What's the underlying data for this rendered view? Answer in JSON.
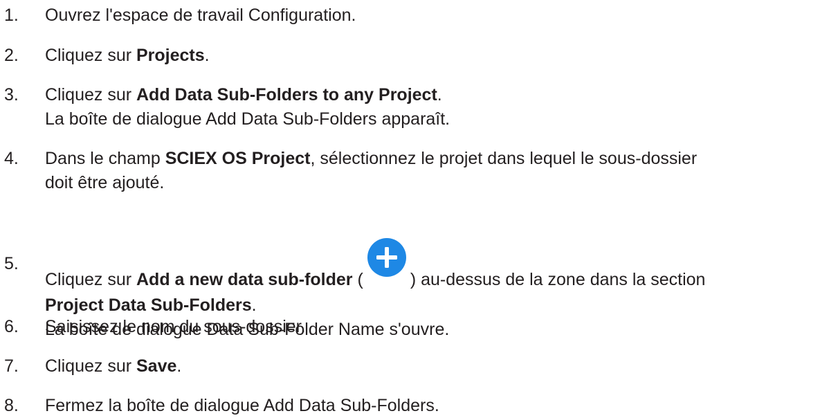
{
  "steps": [
    {
      "number": "1.",
      "text": "Ouvrez l'espace de travail Configuration."
    },
    {
      "number": "2.",
      "prefix": "Cliquez sur ",
      "bold": "Projects",
      "suffix": "."
    },
    {
      "number": "3.",
      "prefix": "Cliquez sur ",
      "bold": "Add Data Sub-Folders to any Project",
      "suffix": ".",
      "result": "La boîte de dialogue Add Data Sub-Folders apparaît."
    },
    {
      "number": "4.",
      "prefix": "Dans le champ ",
      "bold": "SCIEX OS Project",
      "suffix": ", sélectionnez le projet dans lequel le sous-dossier",
      "continuation": "doit être ajouté."
    },
    {
      "number": "5.",
      "prefix": "Cliquez sur ",
      "bold": "Add a new data sub-folder",
      "paren_open": " (",
      "icon": "add-circle-icon",
      "paren_close_text": ") au-dessus de la zone dans la section",
      "bold2": "Project Data Sub-Folders",
      "suffix2": ".",
      "result": "La boîte de dialogue Data Sub-Folder Name s'ouvre."
    },
    {
      "number": "6.",
      "text": "Saisissez le nom du sous-dossier."
    },
    {
      "number": "7.",
      "prefix": "Cliquez sur ",
      "bold": "Save",
      "suffix": "."
    },
    {
      "number": "8.",
      "text": "Fermez la boîte de dialogue Add Data Sub-Folders."
    }
  ],
  "colors": {
    "text": "#231f20",
    "icon_fill": "#1e88e5",
    "icon_glyph": "#ffffff"
  }
}
